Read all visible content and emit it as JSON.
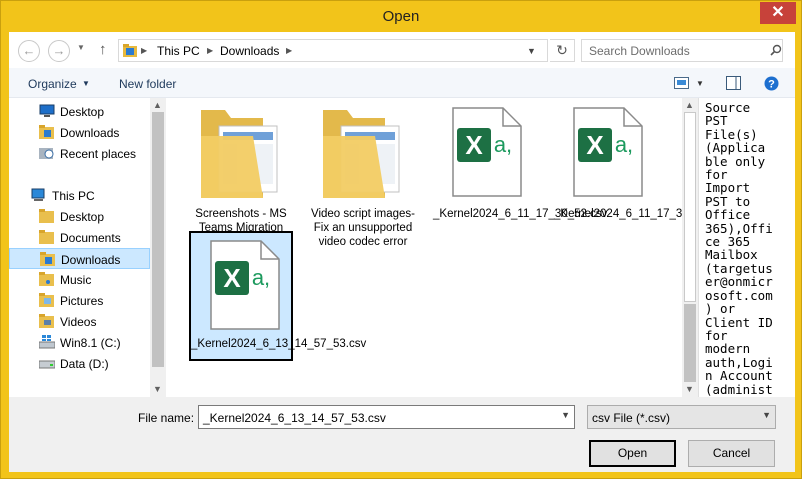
{
  "window": {
    "title": "Open",
    "close_glyph": "✕"
  },
  "address": {
    "crumbs": [
      "This PC",
      "Downloads"
    ],
    "search_placeholder": "Search Downloads"
  },
  "toolbar": {
    "organize": "Organize",
    "new_folder": "New folder"
  },
  "nav": {
    "favorites": [
      {
        "label": "Desktop",
        "icon": "desktop-icon"
      },
      {
        "label": "Downloads",
        "icon": "folder-download-icon"
      },
      {
        "label": "Recent places",
        "icon": "recent-places-icon"
      }
    ],
    "this_pc": {
      "label": "This PC",
      "icon": "computer-icon"
    },
    "pc_items": [
      {
        "label": "Desktop",
        "icon": "folder-icon"
      },
      {
        "label": "Documents",
        "icon": "folder-icon"
      },
      {
        "label": "Downloads",
        "icon": "folder-download-icon",
        "selected": true
      },
      {
        "label": "Music",
        "icon": "folder-music-icon"
      },
      {
        "label": "Pictures",
        "icon": "folder-pictures-icon"
      },
      {
        "label": "Videos",
        "icon": "folder-videos-icon"
      },
      {
        "label": "Win8.1 (C:)",
        "icon": "windows-drive-icon"
      },
      {
        "label": "Data (D:)",
        "icon": "drive-icon"
      }
    ]
  },
  "files": [
    {
      "name": "Screenshots - MS Teams Migration",
      "kind": "folder"
    },
    {
      "name": "Video script images- Fix an unsupported video codec error",
      "kind": "folder"
    },
    {
      "name": "_Kernel2024_6_11_17_30_52.csv",
      "kind": "csv"
    },
    {
      "name": "_Kernel2024_6_11_17_36_2.csv",
      "kind": "csv"
    },
    {
      "name": "_Kernel2024_6_13_14_57_53.csv",
      "kind": "csv",
      "selected": true
    }
  ],
  "preview_text": "Source\nPST\nFile(s)\n(Applica\nble only\nfor\nImport\nPST to\nOffice\n365),Offi\nce 365\nMailbox\n(targetus\ner@onmicr\nosoft.com\n) or\nClient ID\nfor\nmodern\nauth,Logi\nn Account\n(administ\nrator@onm",
  "bottom": {
    "file_name_label": "File name:",
    "file_name_value": "_Kernel2024_6_13_14_57_53.csv",
    "filter_value": "csv File (*.csv)",
    "open_label": "Open",
    "cancel_label": "Cancel"
  },
  "colors": {
    "titlebar": "#f2c41a",
    "close": "#c7423a",
    "selection": "#cce8ff",
    "excel_green": "#1d7044"
  }
}
